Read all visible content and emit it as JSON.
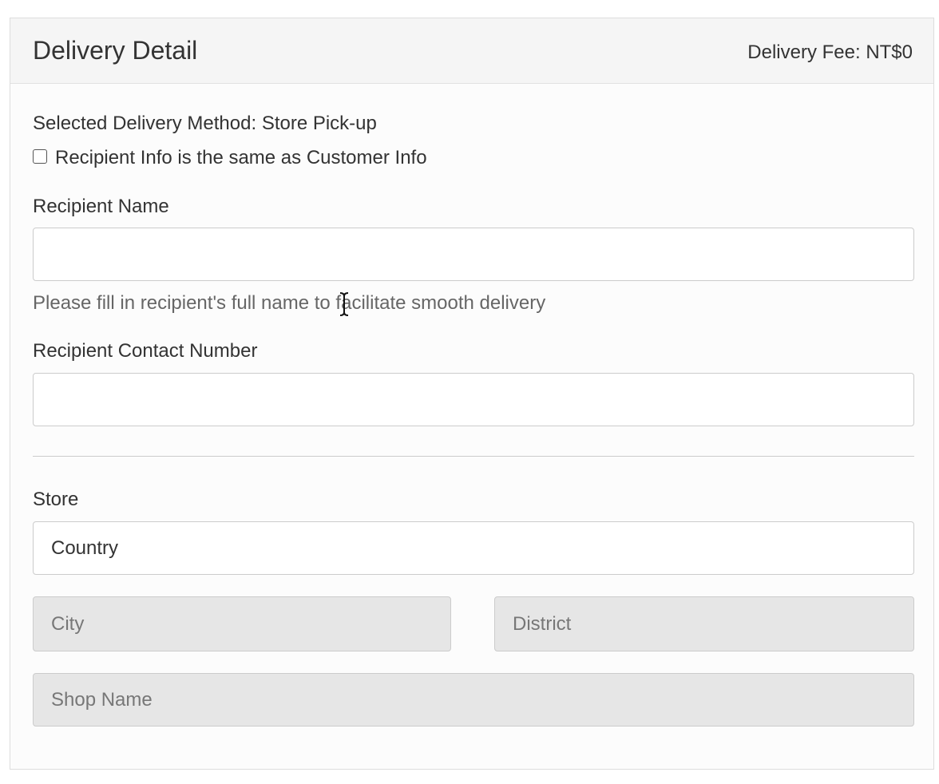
{
  "panel": {
    "title": "Delivery Detail",
    "delivery_fee_label": "Delivery Fee:",
    "delivery_fee_value": "NT$0"
  },
  "delivery_method": {
    "label": "Selected Delivery Method:",
    "value": "Store Pick-up"
  },
  "same_as_customer": {
    "label": "Recipient Info is the same as Customer Info",
    "checked": false
  },
  "recipient_name": {
    "label": "Recipient Name",
    "value": "",
    "help": "Please fill in recipient's full name to facilitate smooth delivery"
  },
  "recipient_contact": {
    "label": "Recipient Contact Number",
    "value": ""
  },
  "store": {
    "label": "Store",
    "country": "Country",
    "city": "City",
    "district": "District",
    "shop_name": "Shop Name"
  },
  "icons": {
    "checkbox": "checkbox-unchecked-icon",
    "cursor": "text-cursor-icon"
  }
}
